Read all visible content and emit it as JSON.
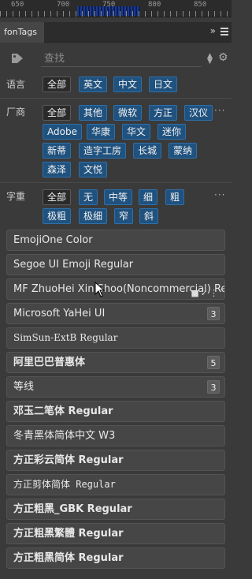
{
  "ruler": {
    "labels": [
      "650",
      "700",
      "750",
      "800",
      "850"
    ]
  },
  "panel": {
    "tab_title": "fonTags",
    "collapse_glyph": "»"
  },
  "search": {
    "placeholder": "查找"
  },
  "filters": {
    "language": {
      "label": "语言",
      "chips": [
        "全部",
        "英文",
        "中文",
        "日文"
      ]
    },
    "vendor": {
      "label": "厂商",
      "chips": [
        "全部",
        "其他",
        "微软",
        "方正",
        "汉仪",
        "Adobe",
        "华康",
        "华文",
        "迷你",
        "新蒂",
        "造字工房",
        "长城",
        "蒙纳",
        "森泽",
        "文悦"
      ]
    },
    "weight": {
      "label": "字重",
      "chips": [
        "全部",
        "无",
        "中等",
        "细",
        "粗",
        "极粗",
        "极细",
        "窄",
        "斜"
      ]
    }
  },
  "fonts": [
    {
      "name": "EmojiOne Color",
      "count": ""
    },
    {
      "name": "Segoe UI Emoji Regular",
      "count": ""
    },
    {
      "name": "MF ZhuoHei Xin Shoo(Noncommercial) Reg",
      "count": ""
    },
    {
      "name": "Microsoft YaHei UI",
      "count": "3"
    },
    {
      "name": "SimSun-ExtB Regular",
      "count": ""
    },
    {
      "name": "阿里巴巴普惠体",
      "count": "5"
    },
    {
      "name": "等线",
      "count": "3"
    },
    {
      "name": "邓玉二笔体 Regular",
      "count": ""
    },
    {
      "name": "冬青黑体简体中文 W3",
      "count": ""
    },
    {
      "name": "方正彩云简体 Regular",
      "count": ""
    },
    {
      "name": "方正剪体简体 Regular",
      "count": ""
    },
    {
      "name": "方正粗黑_GBK Regular",
      "count": ""
    },
    {
      "name": "方正粗黑繁體 Regular",
      "count": ""
    },
    {
      "name": "方正粗黑简体 Regular",
      "count": ""
    }
  ],
  "colors": {
    "chip_bg": "#20527f",
    "panel_bg": "#3a3a3a",
    "item_bg": "#464646"
  }
}
